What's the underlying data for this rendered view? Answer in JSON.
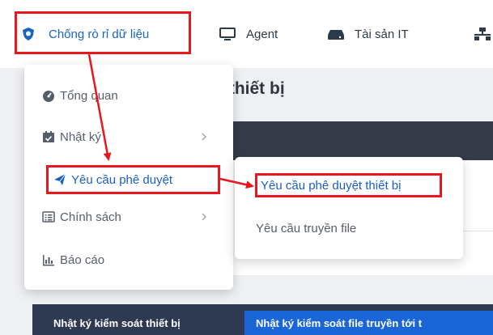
{
  "topnav": {
    "items": [
      {
        "label": "Chống rò rỉ dữ liệu",
        "icon": "shield-icon",
        "active": true
      },
      {
        "label": "Agent",
        "icon": "monitor-icon"
      },
      {
        "label": "Tài sản IT",
        "icon": "hard-drive-icon"
      },
      {
        "label": "",
        "icon": "network-icon"
      }
    ]
  },
  "page": {
    "title": "t thiết bị",
    "tabs": [
      {
        "label": "Nhật ký kiểm soát thiết bị"
      },
      {
        "label": "Nhật ký kiểm soát file truyền tới t"
      }
    ]
  },
  "menu": {
    "items": [
      {
        "label": "Tổng quan",
        "icon": "tachometer-icon"
      },
      {
        "label": "Nhật ký",
        "icon": "calendar-check-icon",
        "has_submenu": true
      },
      {
        "label": "Yêu cầu phê duyệt",
        "icon": "paper-plane-icon",
        "has_submenu": true,
        "active": true
      },
      {
        "label": "Chính sách",
        "icon": "list-alt-icon",
        "has_submenu": true
      },
      {
        "label": "Báo cáo",
        "icon": "bar-chart-icon"
      }
    ]
  },
  "submenu": {
    "items": [
      {
        "label": "Yêu cầu phê duyệt thiết bị",
        "active": true
      },
      {
        "label": "Yêu cầu truyền file"
      }
    ]
  },
  "colors": {
    "accent": "#1a5fc4",
    "highlight": "#e8161d",
    "dark_band": "#353b48",
    "button_blue": "#1a66d9"
  }
}
